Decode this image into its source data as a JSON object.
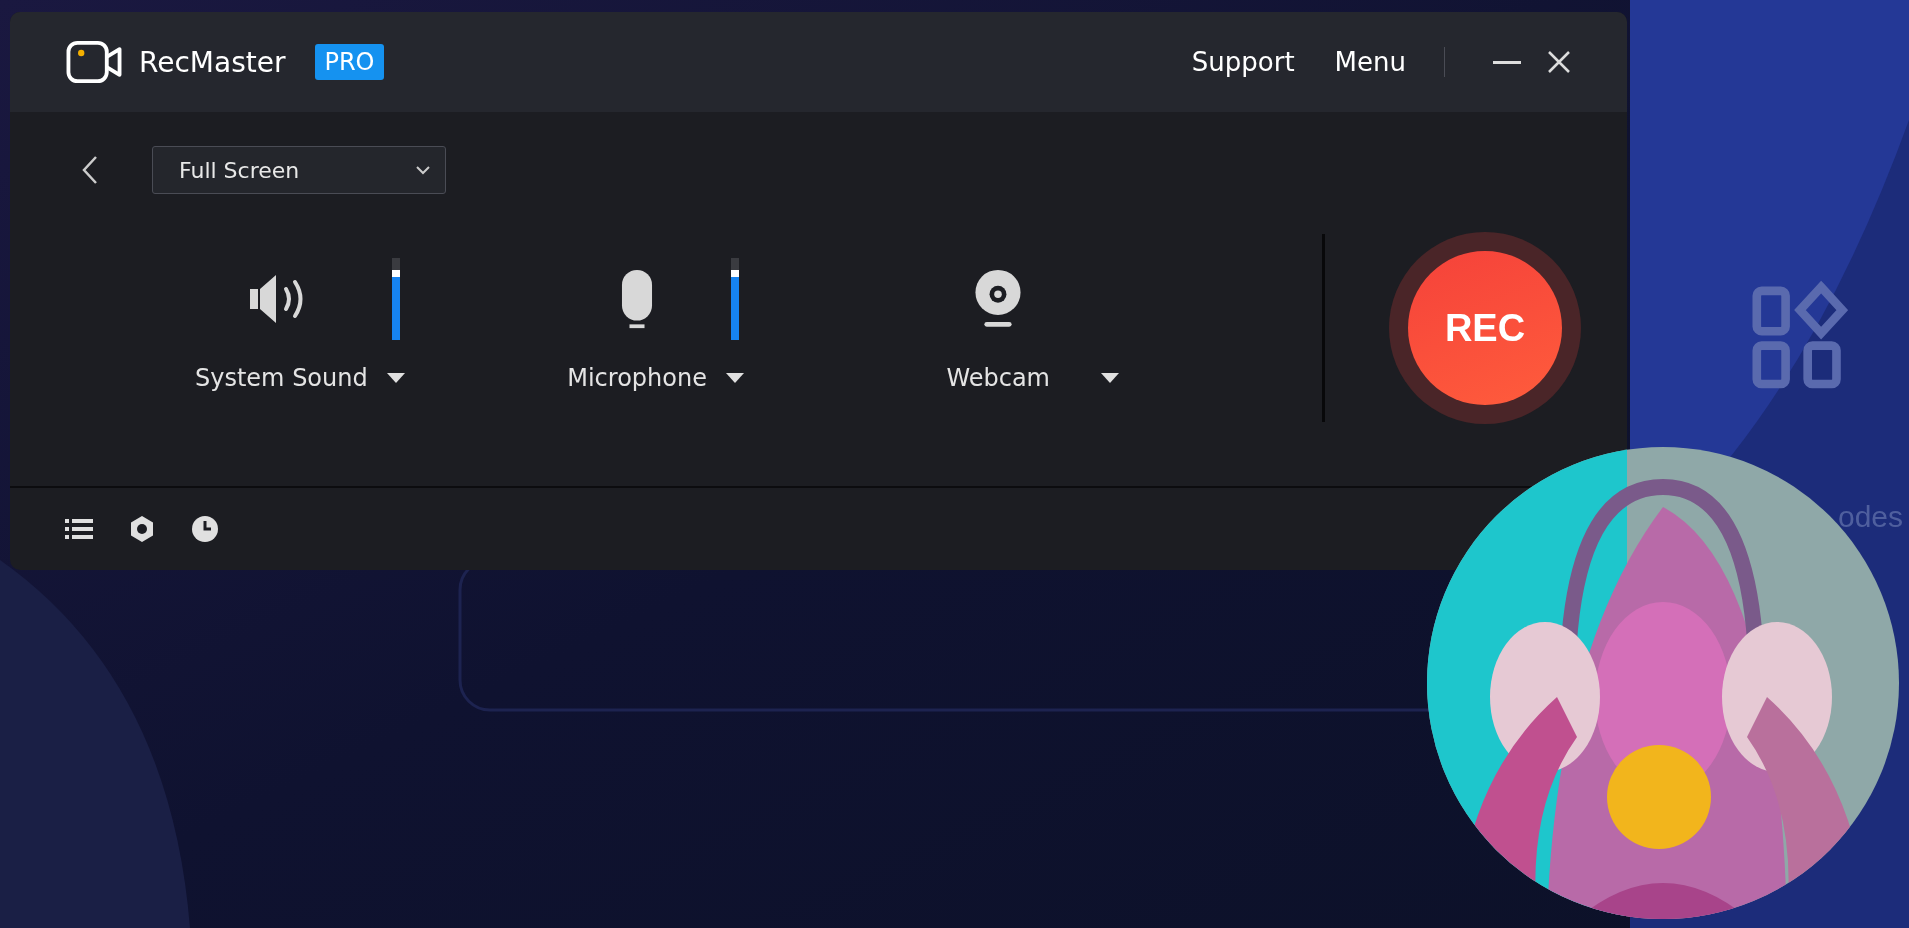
{
  "app": {
    "name": "RecMaster",
    "badge": "PRO"
  },
  "title_bar": {
    "links": [
      "Support",
      "Menu"
    ]
  },
  "capture_area": {
    "value": "Full Screen"
  },
  "sources": [
    {
      "kind": "speaker",
      "label": "System Sound",
      "level": 0.85
    },
    {
      "kind": "microphone",
      "label": "Microphone",
      "level": 0.85
    },
    {
      "kind": "webcam",
      "label": "Webcam"
    }
  ],
  "record_button": {
    "label": "REC"
  },
  "background": {
    "label": "odes"
  }
}
